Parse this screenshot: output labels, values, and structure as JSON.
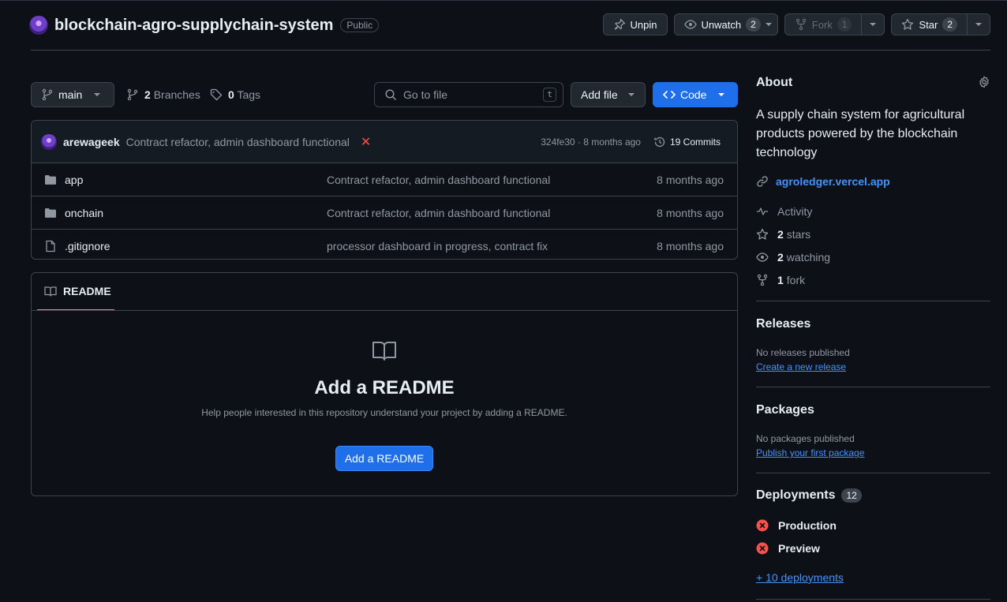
{
  "repo": {
    "name": "blockchain-agro-supplychain-system",
    "visibility": "Public"
  },
  "header_actions": {
    "unpin": "Unpin",
    "unwatch": "Unwatch",
    "watch_count": "2",
    "fork": "Fork",
    "fork_count": "1",
    "star": "Star",
    "star_count": "2"
  },
  "toolbar": {
    "branch": "main",
    "branches_count": "2",
    "branches_label": "Branches",
    "tags_count": "0",
    "tags_label": "Tags",
    "goto_placeholder": "Go to file",
    "goto_shortcut": "t",
    "add_file": "Add file",
    "code": "Code"
  },
  "commit": {
    "author": "arewageek",
    "message": "Contract refactor, admin dashboard functional",
    "status": "✕",
    "meta": "324fe30 · 8 months ago",
    "commits": "19 Commits"
  },
  "files": [
    {
      "type": "dir",
      "name": "app",
      "message": "Contract refactor, admin dashboard functional",
      "time": "8 months ago"
    },
    {
      "type": "dir",
      "name": "onchain",
      "message": "Contract refactor, admin dashboard functional",
      "time": "8 months ago"
    },
    {
      "type": "file",
      "name": ".gitignore",
      "message": "processor dashboard in progress, contract fix",
      "time": "8 months ago"
    }
  ],
  "readme": {
    "tab": "README",
    "title": "Add a README",
    "subtitle": "Help people interested in this repository understand your project by adding a README.",
    "button": "Add a README"
  },
  "about": {
    "title": "About",
    "description": "A supply chain system for agricultural products powered by the blockchain technology",
    "website": "agroledger.vercel.app",
    "activity": "Activity",
    "stars_count": "2",
    "stars_label": "stars",
    "watching_count": "2",
    "watching_label": "watching",
    "forks_count": "1",
    "forks_label": "fork"
  },
  "releases": {
    "title": "Releases",
    "empty": "No releases published",
    "link": "Create a new release"
  },
  "packages": {
    "title": "Packages",
    "empty": "No packages published",
    "link": "Publish your first package"
  },
  "deployments": {
    "title": "Deployments",
    "count": "12",
    "items": [
      "Production",
      "Preview"
    ],
    "more": "+ 10 deployments"
  },
  "colors": {
    "accent": "#1f6feb",
    "link": "#4493f8",
    "error": "#f85149",
    "tab_underline": "#f78166"
  }
}
